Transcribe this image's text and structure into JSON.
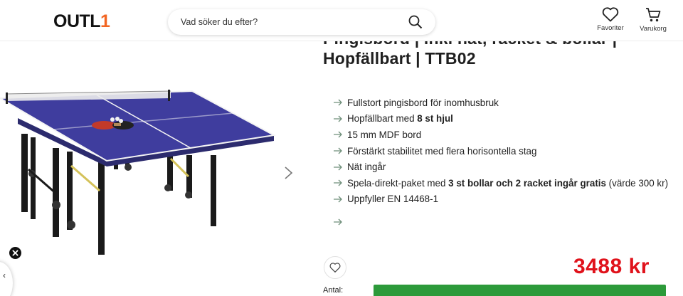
{
  "header": {
    "logo_text": "OUTL",
    "logo_accent": "1",
    "search_placeholder": "Vad söker du efter?",
    "favorites_label": "Favoriter",
    "cart_label": "Varukorg"
  },
  "product": {
    "title_line1": "Pingisbord | inkl nät, racket & bollar |",
    "title_line2": "Hopfällbart | TTB02",
    "features": [
      {
        "pre": "Fullstort pingisbord för inomhusbruk",
        "bold": "",
        "post": ""
      },
      {
        "pre": "Hopfällbart med ",
        "bold": "8 st hjul",
        "post": ""
      },
      {
        "pre": "15 mm MDF bord",
        "bold": "",
        "post": ""
      },
      {
        "pre": "Förstärkt stabilitet med flera horisontella stag",
        "bold": "",
        "post": ""
      },
      {
        "pre": "Nät ingår",
        "bold": "",
        "post": ""
      },
      {
        "pre": "Spela-direkt-paket med ",
        "bold": "3 st bollar och 2 racket ingår gratis",
        "post": " (värde 300 kr)"
      },
      {
        "pre": "Uppfyller EN 14468-1",
        "bold": "",
        "post": ""
      }
    ],
    "price": "3488  kr",
    "quantity_label": "Antal:",
    "side_widget_glyph": "‹"
  },
  "colors": {
    "price": "#e0121b",
    "logo_accent": "#f26522",
    "buy_button": "#2c9a3a",
    "feature_arrow": "#6f8f7a",
    "table_top": "#3f3d9e"
  },
  "icons": [
    "search-icon",
    "heart-icon",
    "cart-icon",
    "chevron-right-icon",
    "arrow-right-icon",
    "close-icon"
  ]
}
